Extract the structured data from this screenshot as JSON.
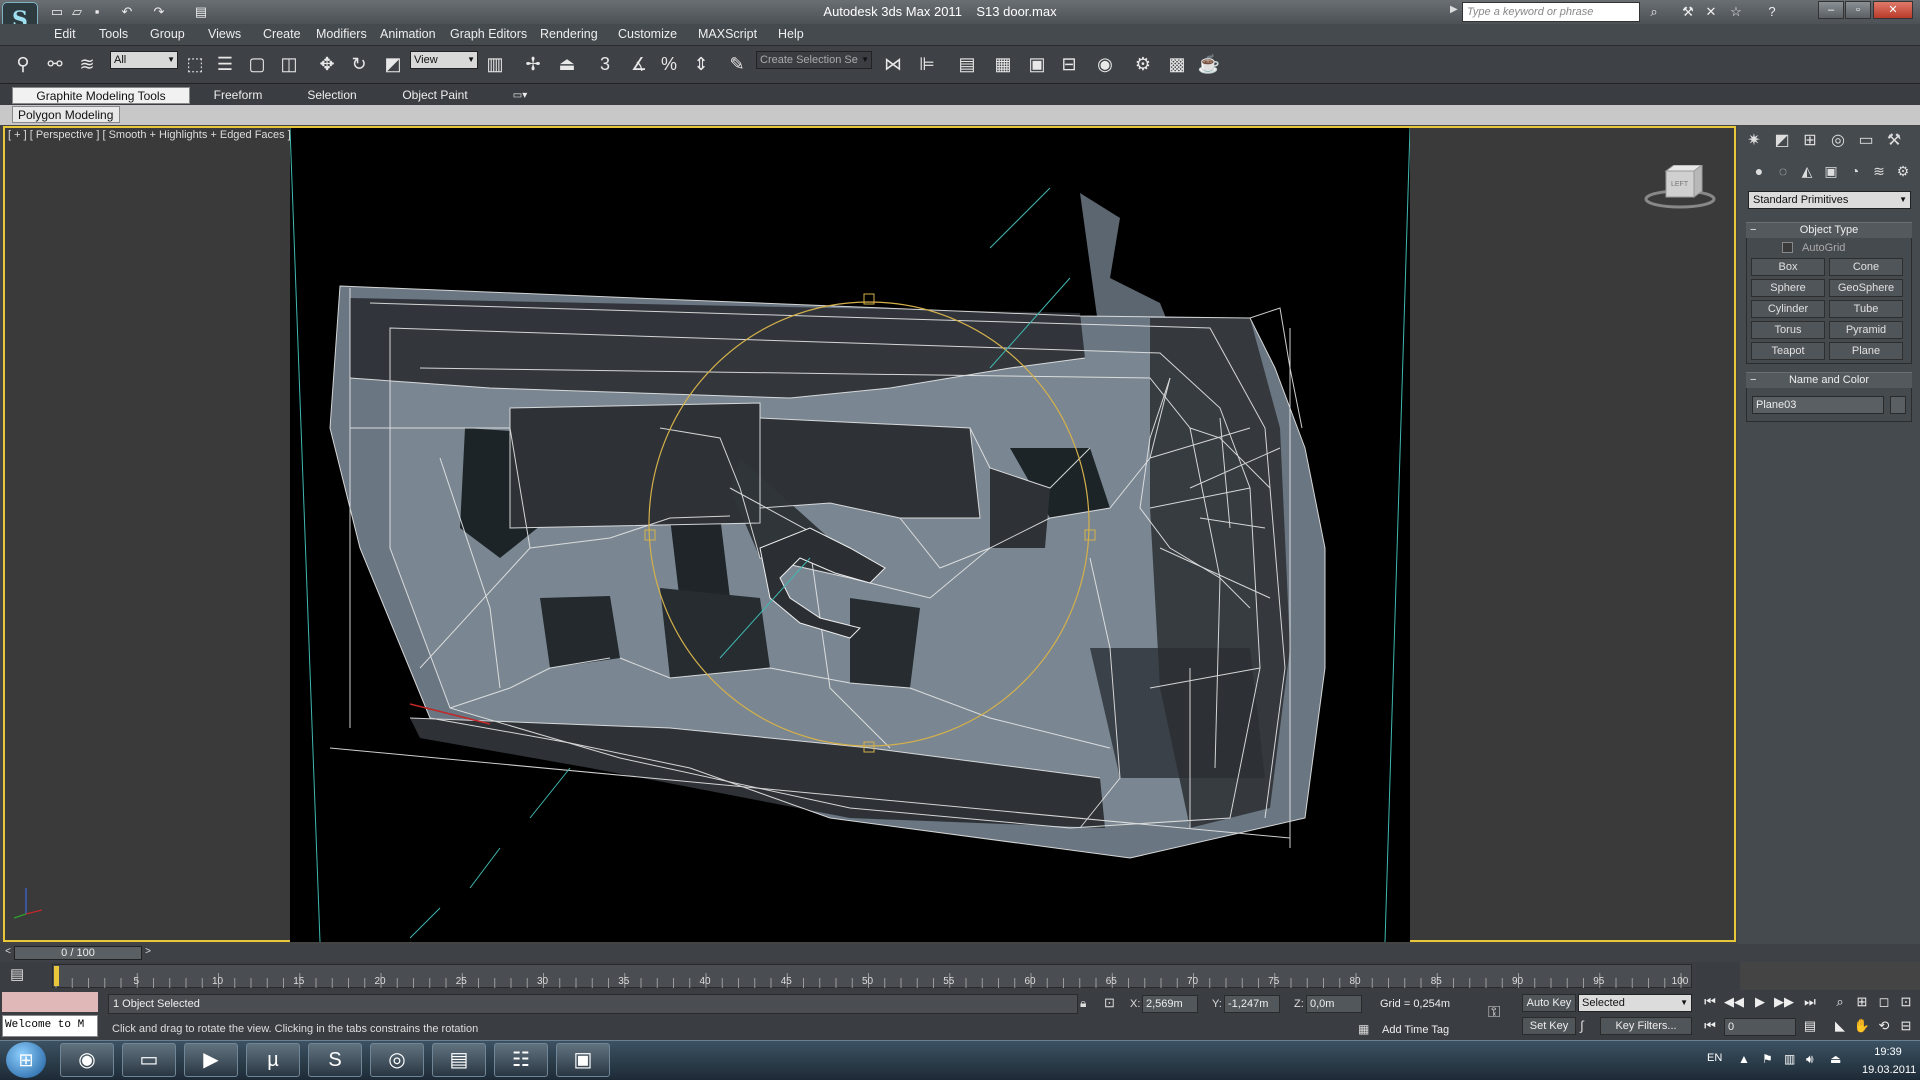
{
  "title": {
    "app": "Autodesk 3ds Max  2011",
    "file": "S13 door.max",
    "search_placeholder": "Type a keyword or phrase"
  },
  "menu": [
    "Edit",
    "Tools",
    "Group",
    "Views",
    "Create",
    "Modifiers",
    "Animation",
    "Graph Editors",
    "Rendering",
    "Customize",
    "MAXScript",
    "Help"
  ],
  "toolbar": {
    "filter": "All",
    "ref_coord": "View",
    "selection_set_placeholder": "Create Selection Se"
  },
  "ribbon": {
    "tabs": [
      "Graphite Modeling Tools",
      "Freeform",
      "Selection",
      "Object Paint"
    ],
    "panel": "Polygon Modeling"
  },
  "viewport": {
    "label": "[ + ] [ Perspective ] [ Smooth + Highlights + Edged Faces ]",
    "viewcube": "LEFT"
  },
  "command_panel": {
    "category": "Standard Primitives",
    "object_type_header": "Object Type",
    "autogrid": "AutoGrid",
    "primitives": [
      "Box",
      "Cone",
      "Sphere",
      "GeoSphere",
      "Cylinder",
      "Tube",
      "Torus",
      "Pyramid",
      "Teapot",
      "Plane"
    ],
    "name_color_header": "Name and Color",
    "object_name": "Plane03"
  },
  "timeline": {
    "current": "0 / 100",
    "ticks": [
      "5",
      "10",
      "15",
      "20",
      "25",
      "30",
      "35",
      "40",
      "45",
      "50",
      "55",
      "60",
      "65",
      "70",
      "75",
      "80",
      "85",
      "90",
      "95",
      "100"
    ]
  },
  "status": {
    "listener": "Welcome to M",
    "objects_selected": "1 Object Selected",
    "prompt": "Click and drag to rotate the view.  Clicking in the tabs constrains the rotation",
    "x_label": "X:",
    "x": "2,569m",
    "y_label": "Y:",
    "y": "-1,247m",
    "z_label": "Z:",
    "z": "0,0m",
    "grid": "Grid = 0,254m",
    "add_time_tag": "Add Time Tag",
    "auto_key": "Auto Key",
    "selected": "Selected",
    "set_key": "Set Key",
    "key_filters": "Key Filters...",
    "frame": "0"
  },
  "taskbar": {
    "lang": "EN",
    "time": "19:39",
    "date": "19.03.2011"
  }
}
